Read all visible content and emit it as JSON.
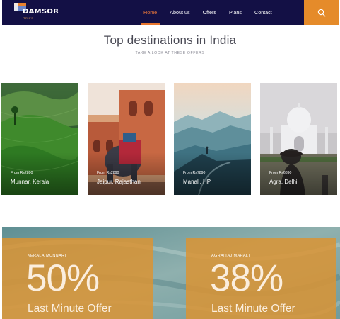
{
  "brand": {
    "name": "DAMSOR",
    "tagline": "TRIPS"
  },
  "nav": {
    "items": [
      {
        "label": "Home",
        "active": true
      },
      {
        "label": "About us",
        "active": false
      },
      {
        "label": "Offers",
        "active": false
      },
      {
        "label": "Plans",
        "active": false
      },
      {
        "label": "Contact",
        "active": false
      }
    ],
    "search_icon": "search-icon"
  },
  "section": {
    "title": "Top destinations in India",
    "subtitle": "TAKE A LOOK AT THESE OFFERS"
  },
  "destinations": [
    {
      "from": "From Rs2890",
      "name": "Munnar, Kerala"
    },
    {
      "from": "From Rs2890",
      "name": "Jaipur, Rajasthan"
    },
    {
      "from": "From Rs7890",
      "name": "Manali, HP"
    },
    {
      "from": "From Rs6890",
      "name": "Agra, Delhi"
    }
  ],
  "offers": [
    {
      "place": "KERALA(MUNNAR)",
      "discount": "50%",
      "label": "Last Minute Offer"
    },
    {
      "place": "AGRA(TAJ MAHAL)",
      "discount": "38%",
      "label": "Last Minute Offer"
    }
  ],
  "colors": {
    "nav_bg": "#131045",
    "accent": "#e58b2a",
    "active_link": "#f07a3a",
    "offer_overlay": "#da9434"
  }
}
